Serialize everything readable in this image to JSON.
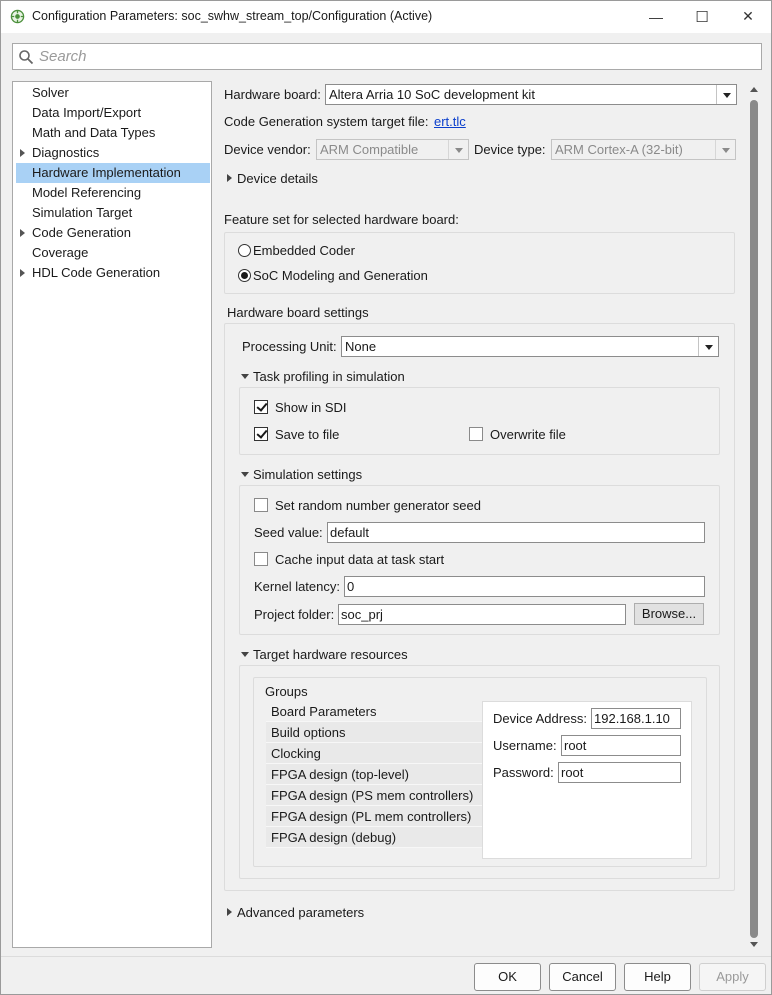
{
  "window": {
    "title": "Configuration Parameters: soc_swhw_stream_top/Configuration (Active)",
    "controls": {
      "minimize": "—",
      "maximize": "☐",
      "close": "✕"
    }
  },
  "search": {
    "placeholder": "Search",
    "value": ""
  },
  "tree": {
    "items": [
      {
        "label": "Solver",
        "expandable": false
      },
      {
        "label": "Data Import/Export",
        "expandable": false
      },
      {
        "label": "Math and Data Types",
        "expandable": false
      },
      {
        "label": "Diagnostics",
        "expandable": true
      },
      {
        "label": "Hardware Implementation",
        "expandable": false,
        "selected": true
      },
      {
        "label": "Model Referencing",
        "expandable": false
      },
      {
        "label": "Simulation Target",
        "expandable": false
      },
      {
        "label": "Code Generation",
        "expandable": true
      },
      {
        "label": "Coverage",
        "expandable": false
      },
      {
        "label": "HDL Code Generation",
        "expandable": true
      }
    ],
    "selected_color": "#a9d1f5"
  },
  "hardware": {
    "board_label": "Hardware board:",
    "board_value": "Altera Arria 10 SoC development kit",
    "target_file_label": "Code Generation system target file:",
    "target_file_link": "ert.tlc",
    "vendor_label": "Device vendor:",
    "vendor_value": "ARM Compatible",
    "type_label": "Device type:",
    "type_value": "ARM Cortex-A (32-bit)",
    "device_details": "Device details"
  },
  "feature_set": {
    "label": "Feature set for selected hardware board:",
    "options": [
      {
        "label": "Embedded Coder",
        "checked": false
      },
      {
        "label": "SoC Modeling and Generation",
        "checked": true
      }
    ]
  },
  "board_settings": {
    "title": "Hardware board settings",
    "processing_unit_label": "Processing Unit:",
    "processing_unit_value": "None",
    "task_profiling": {
      "title": "Task profiling in simulation",
      "show_in_sdi": "Show in SDI",
      "show_in_sdi_checked": true,
      "save_to_file": "Save to file",
      "save_to_file_checked": true,
      "overwrite_file": "Overwrite file",
      "overwrite_file_checked": false
    },
    "simulation": {
      "title": "Simulation settings",
      "random_seed": "Set random number generator seed",
      "random_seed_checked": false,
      "seed_label": "Seed value:",
      "seed_value": "default",
      "cache_input": "Cache input data at task start",
      "cache_input_checked": false,
      "kernel_label": "Kernel latency:",
      "kernel_value": "0",
      "project_label": "Project folder:",
      "project_value": "soc_prj",
      "browse": "Browse..."
    },
    "target_resources": {
      "title": "Target hardware resources",
      "groups_label": "Groups",
      "groups": [
        "Board Parameters",
        "Build options",
        "Clocking",
        "FPGA design (top-level)",
        "FPGA design (PS mem controllers)",
        "FPGA design (PL mem controllers)",
        "FPGA design (debug)"
      ],
      "device_address_label": "Device Address:",
      "device_address_value": "192.168.1.10",
      "username_label": "Username:",
      "username_value": "root",
      "password_label": "Password:",
      "password_value": "root"
    }
  },
  "advanced": "Advanced parameters",
  "footer": {
    "ok": "OK",
    "cancel": "Cancel",
    "help": "Help",
    "apply": "Apply"
  }
}
